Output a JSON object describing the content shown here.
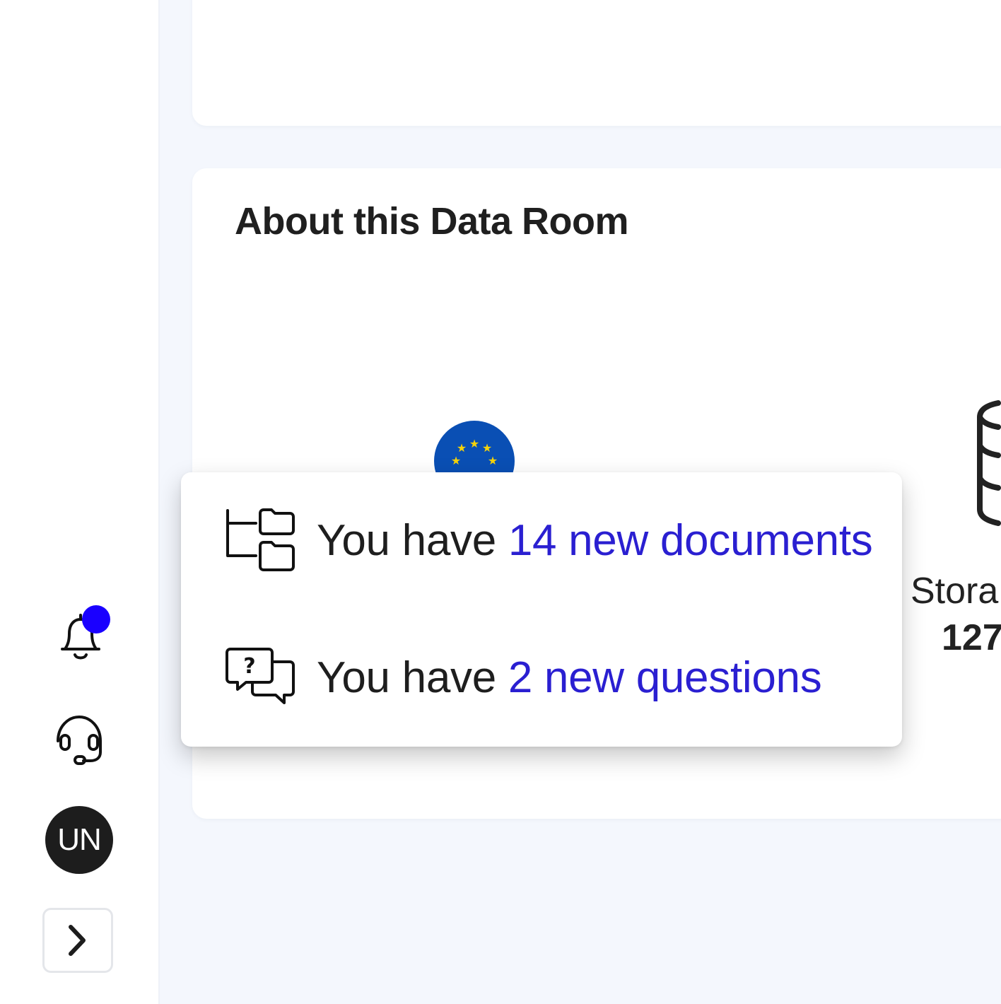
{
  "colors": {
    "accent": "#2a1fd1",
    "notification_dot": "#1a00ff",
    "background": "#f4f7fd",
    "avatar_bg": "#1d1d1d",
    "eu_flag_blue": "#0a4fb4",
    "eu_flag_star": "#f5d20a"
  },
  "sidebar": {
    "notifications_icon": "bell-icon",
    "notification_indicator": "dot",
    "support_icon": "headset-icon",
    "avatar_initials": "UN",
    "expand_icon": "chevron-right-icon"
  },
  "about_card": {
    "title": "About this Data Room",
    "region_icon": "eu-flag-icon",
    "storage_icon": "database-icon",
    "storage_label": "Stora",
    "storage_value": "127"
  },
  "popover": {
    "items": [
      {
        "icon": "folder-tree-icon",
        "prefix": "You have ",
        "link": "14 new documents"
      },
      {
        "icon": "question-chat-icon",
        "prefix": "You have ",
        "link": "2 new questions"
      }
    ]
  }
}
